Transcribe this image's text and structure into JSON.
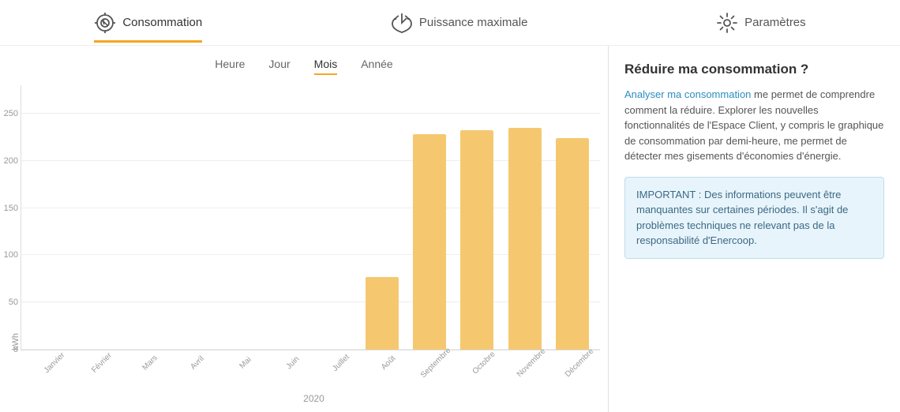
{
  "nav": {
    "items": [
      {
        "id": "consommation",
        "label": "Consommation",
        "active": true
      },
      {
        "id": "puissance",
        "label": "Puissance maximale",
        "active": false
      },
      {
        "id": "parametres",
        "label": "Paramètres",
        "active": false
      }
    ]
  },
  "tabs": {
    "items": [
      {
        "id": "heure",
        "label": "Heure",
        "active": false
      },
      {
        "id": "jour",
        "label": "Jour",
        "active": false
      },
      {
        "id": "mois",
        "label": "Mois",
        "active": true
      },
      {
        "id": "annee",
        "label": "Année",
        "active": false
      }
    ]
  },
  "chart": {
    "yLabel": "kWh",
    "yTicks": [
      0,
      50,
      100,
      150,
      200,
      250
    ],
    "maxValue": 280,
    "year": "2020",
    "bars": [
      {
        "label": "Janvier",
        "value": 0
      },
      {
        "label": "Février",
        "value": 0
      },
      {
        "label": "Mars",
        "value": 0
      },
      {
        "label": "Avril",
        "value": 0
      },
      {
        "label": "Mai",
        "value": 0
      },
      {
        "label": "Juin",
        "value": 0
      },
      {
        "label": "Juillet",
        "value": 0
      },
      {
        "label": "Août",
        "value": 77
      },
      {
        "label": "Septembre",
        "value": 228
      },
      {
        "label": "Octobre",
        "value": 232
      },
      {
        "label": "Novembre",
        "value": 235
      },
      {
        "label": "Décembre",
        "value": 224
      }
    ]
  },
  "panel": {
    "title": "Réduire ma consommation ?",
    "link_text": "Analyser ma consommation",
    "description": " me permet de comprendre comment la réduire. Explorer les nouvelles fonctionnalités de l'Espace Client, y compris le graphique de consommation par demi-heure, me permet de détecter mes gisements d'économies d'énergie.",
    "info_text": "IMPORTANT : Des informations peuvent être manquantes sur certaines périodes. Il s'agit de problèmes techniques ne relevant pas de la responsabilité d'Enercoop."
  }
}
